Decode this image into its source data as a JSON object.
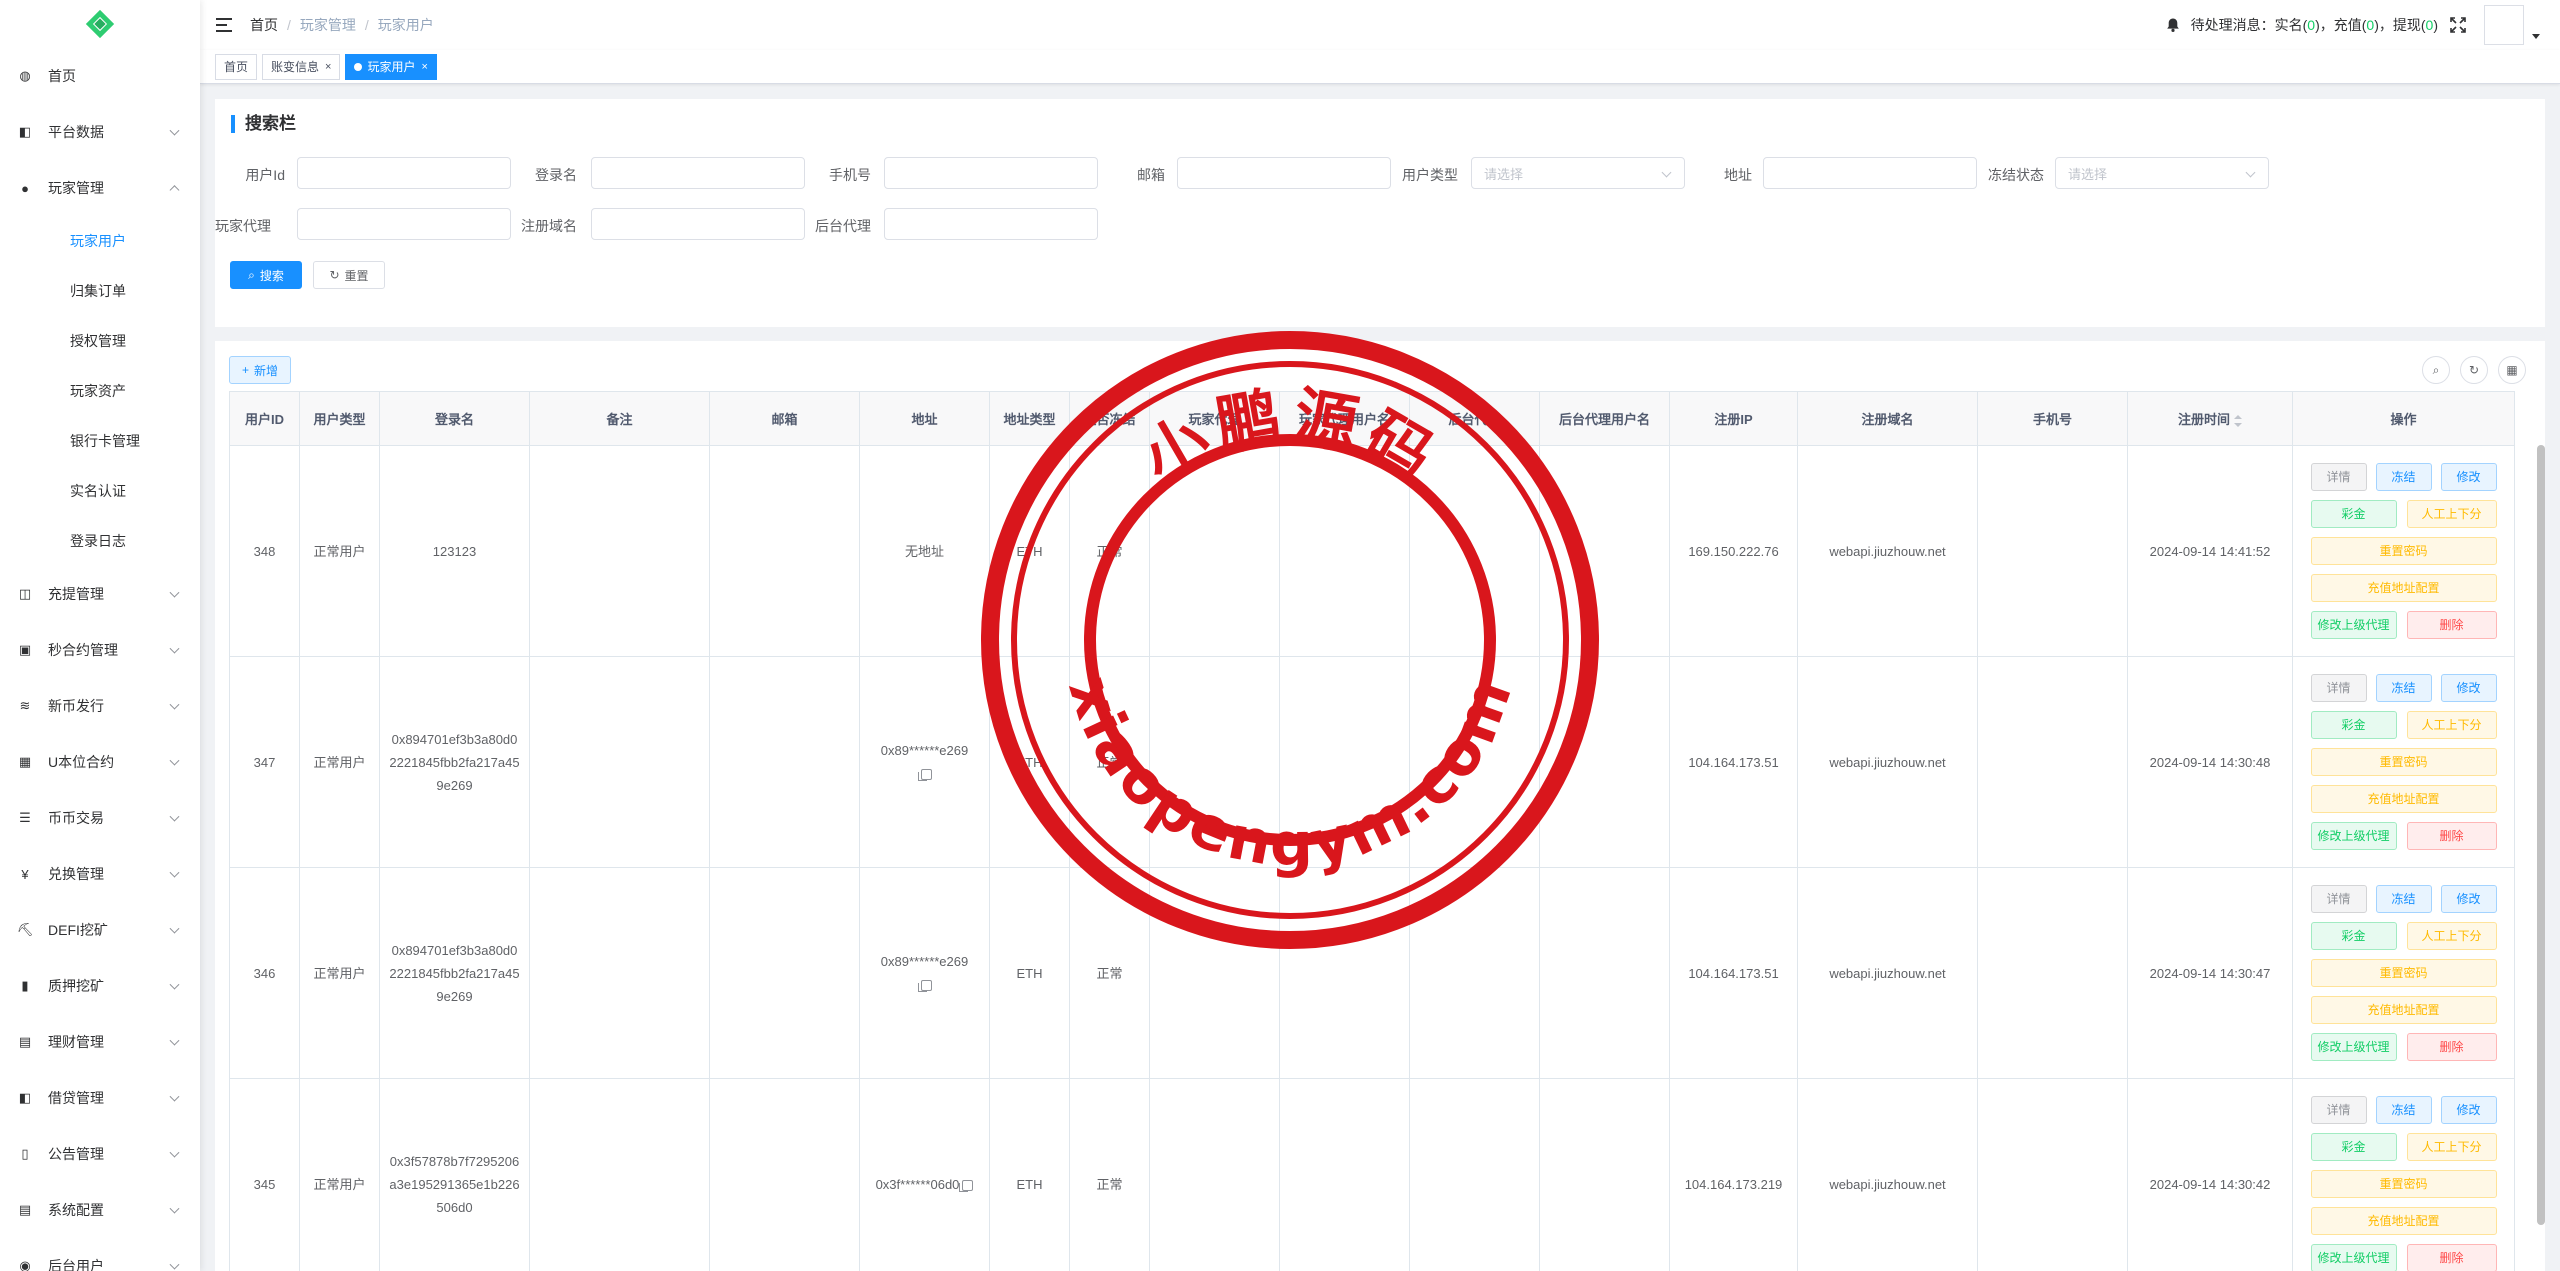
{
  "sidebar": {
    "items": [
      {
        "label": "首页",
        "icon": "dashboard-icon",
        "icon_glyph": "◍",
        "expandable": false
      },
      {
        "label": "平台数据",
        "icon": "data-icon",
        "icon_glyph": "◧",
        "expandable": true
      },
      {
        "label": "玩家管理",
        "icon": "user-icon",
        "icon_glyph": "●",
        "expandable": true,
        "expanded": true
      },
      {
        "label": "充提管理",
        "icon": "deposit-icon",
        "icon_glyph": "◫",
        "expandable": true
      },
      {
        "label": "秒合约管理",
        "icon": "contract-icon",
        "icon_glyph": "▣",
        "expandable": true
      },
      {
        "label": "新币发行",
        "icon": "coin-icon",
        "icon_glyph": "≋",
        "expandable": true
      },
      {
        "label": "U本位合约",
        "icon": "grid-icon",
        "icon_glyph": "▦",
        "expandable": true
      },
      {
        "label": "币币交易",
        "icon": "list-icon",
        "icon_glyph": "☰",
        "expandable": true
      },
      {
        "label": "兑换管理",
        "icon": "yen-icon",
        "icon_glyph": "¥",
        "expandable": true
      },
      {
        "label": "DEFI挖矿",
        "icon": "mining-icon",
        "icon_glyph": "⛏",
        "expandable": true
      },
      {
        "label": "质押挖矿",
        "icon": "bar-chart-icon",
        "icon_glyph": "▮",
        "expandable": true
      },
      {
        "label": "理财管理",
        "icon": "finance-icon",
        "icon_glyph": "▤",
        "expandable": true
      },
      {
        "label": "借贷管理",
        "icon": "loan-icon",
        "icon_glyph": "◧",
        "expandable": true
      },
      {
        "label": "公告管理",
        "icon": "book-icon",
        "icon_glyph": "▯",
        "expandable": true
      },
      {
        "label": "系统配置",
        "icon": "config-icon",
        "icon_glyph": "▤",
        "expandable": true
      },
      {
        "label": "后台用户",
        "icon": "admin-icon",
        "icon_glyph": "◉",
        "expandable": true
      }
    ],
    "player_sub": [
      "玩家用户",
      "归集订单",
      "授权管理",
      "玩家资产",
      "银行卡管理",
      "实名认证",
      "登录日志"
    ]
  },
  "header": {
    "breadcrumb": [
      "首页",
      "玩家管理",
      "玩家用户"
    ],
    "notice_prefix": "待处理消息：实名(",
    "realname_count": "0",
    "notice_mid1": ")，充值(",
    "recharge_count": "0",
    "notice_mid2": ")，提现(",
    "withdraw_count": "0",
    "notice_suffix": ")"
  },
  "tags": [
    "首页",
    "账变信息",
    "玩家用户"
  ],
  "search": {
    "title": "搜索栏",
    "labels": {
      "user_id": "用户Id",
      "login_name": "登录名",
      "phone": "手机号",
      "email": "邮箱",
      "user_type": "用户类型",
      "address": "地址",
      "freeze_status": "冻结状态",
      "player_agent": "玩家代理",
      "reg_domain": "注册域名",
      "admin_agent": "后台代理"
    },
    "select_placeholder": "请选择",
    "search_button": "搜索",
    "reset_button": "重置"
  },
  "table": {
    "add_button": "新增",
    "columns": [
      "用户ID",
      "用户类型",
      "登录名",
      "备注",
      "邮箱",
      "地址",
      "地址类型",
      "是否冻结",
      "玩家代理",
      "玩家代理用户名",
      "后台代理",
      "后台代理用户名",
      "注册IP",
      "注册域名",
      "手机号",
      "注册时间",
      "操作"
    ],
    "rows": [
      {
        "id": "348",
        "type": "正常用户",
        "login": "123123",
        "remark": "",
        "email": "",
        "address": "无地址",
        "has_copy": false,
        "addr_type": "ETH",
        "frozen": "正常",
        "p_agent": "",
        "p_agent_name": "",
        "a_agent": "",
        "a_agent_name": "",
        "ip": "169.150.222.76",
        "domain": "webapi.jiuzhouw.net",
        "phone": "",
        "time": "2024-09-14 14:41:52"
      },
      {
        "id": "347",
        "type": "正常用户",
        "login": "0x894701ef3b3a80d02221845fbb2fa217a459e269",
        "remark": "",
        "email": "",
        "address": "0x89******e269",
        "has_copy": true,
        "addr_type": "ETH",
        "frozen": "正常",
        "p_agent": "",
        "p_agent_name": "",
        "a_agent": "",
        "a_agent_name": "",
        "ip": "104.164.173.51",
        "domain": "webapi.jiuzhouw.net",
        "phone": "",
        "time": "2024-09-14 14:30:48"
      },
      {
        "id": "346",
        "type": "正常用户",
        "login": "0x894701ef3b3a80d02221845fbb2fa217a459e269",
        "remark": "",
        "email": "",
        "address": "0x89******e269",
        "has_copy": true,
        "addr_type": "ETH",
        "frozen": "正常",
        "p_agent": "",
        "p_agent_name": "",
        "a_agent": "",
        "a_agent_name": "",
        "ip": "104.164.173.51",
        "domain": "webapi.jiuzhouw.net",
        "phone": "",
        "time": "2024-09-14 14:30:47"
      },
      {
        "id": "345",
        "type": "正常用户",
        "login": "0x3f57878b7f7295206a3e195291365e1b226506d0",
        "remark": "",
        "email": "",
        "address": "0x3f******06d0",
        "has_copy": true,
        "addr_type": "ETH",
        "frozen": "正常",
        "p_agent": "",
        "p_agent_name": "",
        "a_agent": "",
        "a_agent_name": "",
        "ip": "104.164.173.219",
        "domain": "webapi.jiuzhouw.net",
        "phone": "",
        "time": "2024-09-14 14:30:42"
      }
    ],
    "ops": {
      "detail": "详情",
      "freeze": "冻结",
      "edit": "修改",
      "bonus": "彩金",
      "manual": "人工上下分",
      "reset_pwd": "重置密码",
      "addr_config": "充值地址配置",
      "change_agent": "修改上级代理",
      "delete": "删除"
    }
  },
  "watermark": {
    "top_text": "小鹏源码",
    "bottom_text": "xiaopengym.com",
    "color": "#d9161c"
  }
}
